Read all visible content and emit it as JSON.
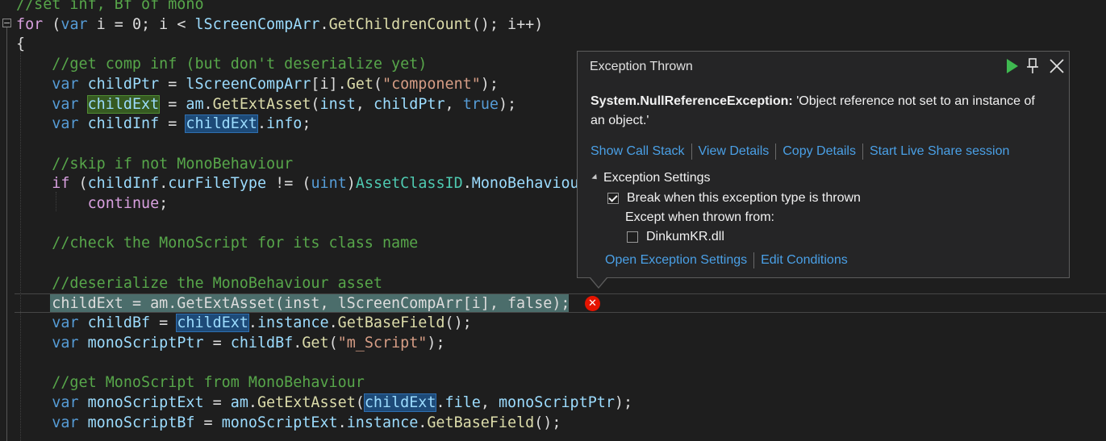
{
  "code_lines": [
    [
      {
        "t": "//set inf, Bf of mono",
        "c": "cm"
      }
    ],
    [
      {
        "t": "for",
        "c": "ctl"
      },
      {
        "t": " ("
      },
      {
        "t": "var",
        "c": "kw"
      },
      {
        "t": " i = 0; i < "
      },
      {
        "t": "lScreenCompArr",
        "c": "vr"
      },
      {
        "t": "."
      },
      {
        "t": "GetChildrenCount",
        "c": "fn"
      },
      {
        "t": "(); i++)"
      }
    ],
    [
      {
        "t": "{"
      }
    ],
    [
      {
        "t": "    //get comp inf (but don't deserialize yet)",
        "c": "cm"
      }
    ],
    [
      {
        "t": "    "
      },
      {
        "t": "var",
        "c": "kw"
      },
      {
        "t": " "
      },
      {
        "t": "childPtr",
        "c": "vr"
      },
      {
        "t": " = "
      },
      {
        "t": "lScreenCompArr",
        "c": "vr"
      },
      {
        "t": "[i]."
      },
      {
        "t": "Get",
        "c": "fn"
      },
      {
        "t": "("
      },
      {
        "t": "\"component\"",
        "c": "st"
      },
      {
        "t": ");"
      }
    ],
    [
      {
        "t": "    "
      },
      {
        "t": "var",
        "c": "kw"
      },
      {
        "t": " "
      },
      {
        "t": "childExt",
        "c": "vr",
        "h": "green"
      },
      {
        "t": " = "
      },
      {
        "t": "am",
        "c": "vr"
      },
      {
        "t": "."
      },
      {
        "t": "GetExtAsset",
        "c": "fn"
      },
      {
        "t": "("
      },
      {
        "t": "inst",
        "c": "vr"
      },
      {
        "t": ", "
      },
      {
        "t": "childPtr",
        "c": "vr"
      },
      {
        "t": ", "
      },
      {
        "t": "true",
        "c": "kw"
      },
      {
        "t": ");"
      }
    ],
    [
      {
        "t": "    "
      },
      {
        "t": "var",
        "c": "kw"
      },
      {
        "t": " "
      },
      {
        "t": "childInf",
        "c": "vr"
      },
      {
        "t": " = "
      },
      {
        "t": "childExt",
        "c": "vr",
        "h": "blue"
      },
      {
        "t": "."
      },
      {
        "t": "info",
        "c": "vr"
      },
      {
        "t": ";"
      }
    ],
    [],
    [
      {
        "t": "    //skip if not MonoBehaviour",
        "c": "cm"
      }
    ],
    [
      {
        "t": "    "
      },
      {
        "t": "if",
        "c": "ctl"
      },
      {
        "t": " ("
      },
      {
        "t": "childInf",
        "c": "vr"
      },
      {
        "t": "."
      },
      {
        "t": "curFileType",
        "c": "vr"
      },
      {
        "t": " != ("
      },
      {
        "t": "uint",
        "c": "kw"
      },
      {
        "t": ")"
      },
      {
        "t": "AssetClassID",
        "c": "ty"
      },
      {
        "t": "."
      },
      {
        "t": "MonoBehaviour",
        "c": "vr"
      }
    ],
    [
      {
        "t": "        "
      },
      {
        "t": "continue",
        "c": "ctl"
      },
      {
        "t": ";"
      }
    ],
    [],
    [
      {
        "t": "    //check the MonoScript for its class name",
        "c": "cm"
      }
    ],
    [],
    [
      {
        "t": "    //deserialize the MonoBehaviour asset",
        "c": "cm"
      }
    ],
    [
      {
        "t": "    "
      },
      {
        "t": "childExt = am.GetExtAsset(inst, lScreenCompArr[i], false);"
      }
    ],
    [
      {
        "t": "    "
      },
      {
        "t": "var",
        "c": "kw"
      },
      {
        "t": " "
      },
      {
        "t": "childBf",
        "c": "vr"
      },
      {
        "t": " = "
      },
      {
        "t": "childExt",
        "c": "vr",
        "h": "blue"
      },
      {
        "t": "."
      },
      {
        "t": "instance",
        "c": "vr"
      },
      {
        "t": "."
      },
      {
        "t": "GetBaseField",
        "c": "fn"
      },
      {
        "t": "();"
      }
    ],
    [
      {
        "t": "    "
      },
      {
        "t": "var",
        "c": "kw"
      },
      {
        "t": " "
      },
      {
        "t": "monoScriptPtr",
        "c": "vr"
      },
      {
        "t": " = "
      },
      {
        "t": "childBf",
        "c": "vr"
      },
      {
        "t": "."
      },
      {
        "t": "Get",
        "c": "fn"
      },
      {
        "t": "("
      },
      {
        "t": "\"m_Script\"",
        "c": "st"
      },
      {
        "t": ");"
      }
    ],
    [],
    [
      {
        "t": "    //get MonoScript from MonoBehaviour",
        "c": "cm"
      }
    ],
    [
      {
        "t": "    "
      },
      {
        "t": "var",
        "c": "kw"
      },
      {
        "t": " "
      },
      {
        "t": "monoScriptExt",
        "c": "vr"
      },
      {
        "t": " = "
      },
      {
        "t": "am",
        "c": "vr"
      },
      {
        "t": "."
      },
      {
        "t": "GetExtAsset",
        "c": "fn"
      },
      {
        "t": "("
      },
      {
        "t": "childExt",
        "c": "vr",
        "h": "blue"
      },
      {
        "t": "."
      },
      {
        "t": "file",
        "c": "vr"
      },
      {
        "t": ", "
      },
      {
        "t": "monoScriptPtr",
        "c": "vr"
      },
      {
        "t": ");"
      }
    ],
    [
      {
        "t": "    "
      },
      {
        "t": "var",
        "c": "kw"
      },
      {
        "t": " "
      },
      {
        "t": "monoScriptBf",
        "c": "vr"
      },
      {
        "t": " = "
      },
      {
        "t": "monoScriptExt",
        "c": "vr"
      },
      {
        "t": "."
      },
      {
        "t": "instance",
        "c": "vr"
      },
      {
        "t": "."
      },
      {
        "t": "GetBaseField",
        "c": "fn"
      },
      {
        "t": "();"
      }
    ]
  ],
  "exception": {
    "title": "Exception Thrown",
    "exception_type": "System.NullReferenceException:",
    "message": " 'Object reference not set to an instance of an object.'",
    "links": [
      "Show Call Stack",
      "View Details",
      "Copy Details",
      "Start Live Share session"
    ],
    "settings_header": "Exception Settings",
    "break_label": "Break when this exception type is thrown",
    "break_checked": true,
    "except_label": "Except when thrown from:",
    "module_label": "DinkumKR.dll",
    "module_checked": false,
    "bottom_links": [
      "Open Exception Settings",
      "Edit Conditions"
    ]
  },
  "colors": {
    "error": "#e51400",
    "play": "#3fb950",
    "link": "#4aa0e6"
  },
  "icons": {
    "play": "continue-play-icon",
    "pin": "pin-icon",
    "close": "close-icon",
    "error": "error-icon"
  }
}
